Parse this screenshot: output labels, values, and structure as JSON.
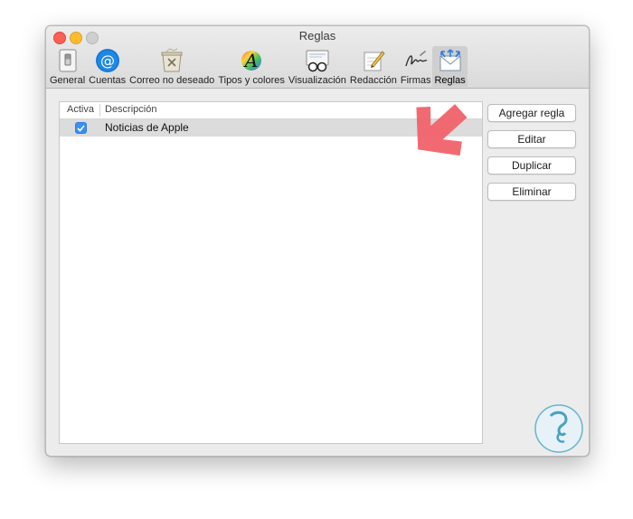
{
  "window": {
    "title": "Reglas"
  },
  "toolbar": {
    "items": [
      {
        "label": "General",
        "icon": "switch-icon"
      },
      {
        "label": "Cuentas",
        "icon": "at-sign-icon"
      },
      {
        "label": "Correo no deseado",
        "icon": "junk-mail-icon"
      },
      {
        "label": "Tipos y colores",
        "icon": "fonts-colors-icon"
      },
      {
        "label": "Visualización",
        "icon": "viewing-glasses-icon"
      },
      {
        "label": "Redacción",
        "icon": "composing-icon"
      },
      {
        "label": "Firmas",
        "icon": "signature-icon"
      },
      {
        "label": "Reglas",
        "icon": "rules-envelope-icon"
      }
    ],
    "selected": "Reglas"
  },
  "rules_table": {
    "columns": [
      "Activa",
      "Descripción"
    ],
    "rows": [
      {
        "active": true,
        "description": "Noticias de Apple"
      }
    ]
  },
  "buttons": {
    "add": "Agregar regla",
    "edit": "Editar",
    "duplicate": "Duplicar",
    "delete": "Eliminar"
  },
  "colors": {
    "accent": "#3a8ef6",
    "annotation_arrow": "#f0626a",
    "watermark": "#4aa0c0"
  }
}
